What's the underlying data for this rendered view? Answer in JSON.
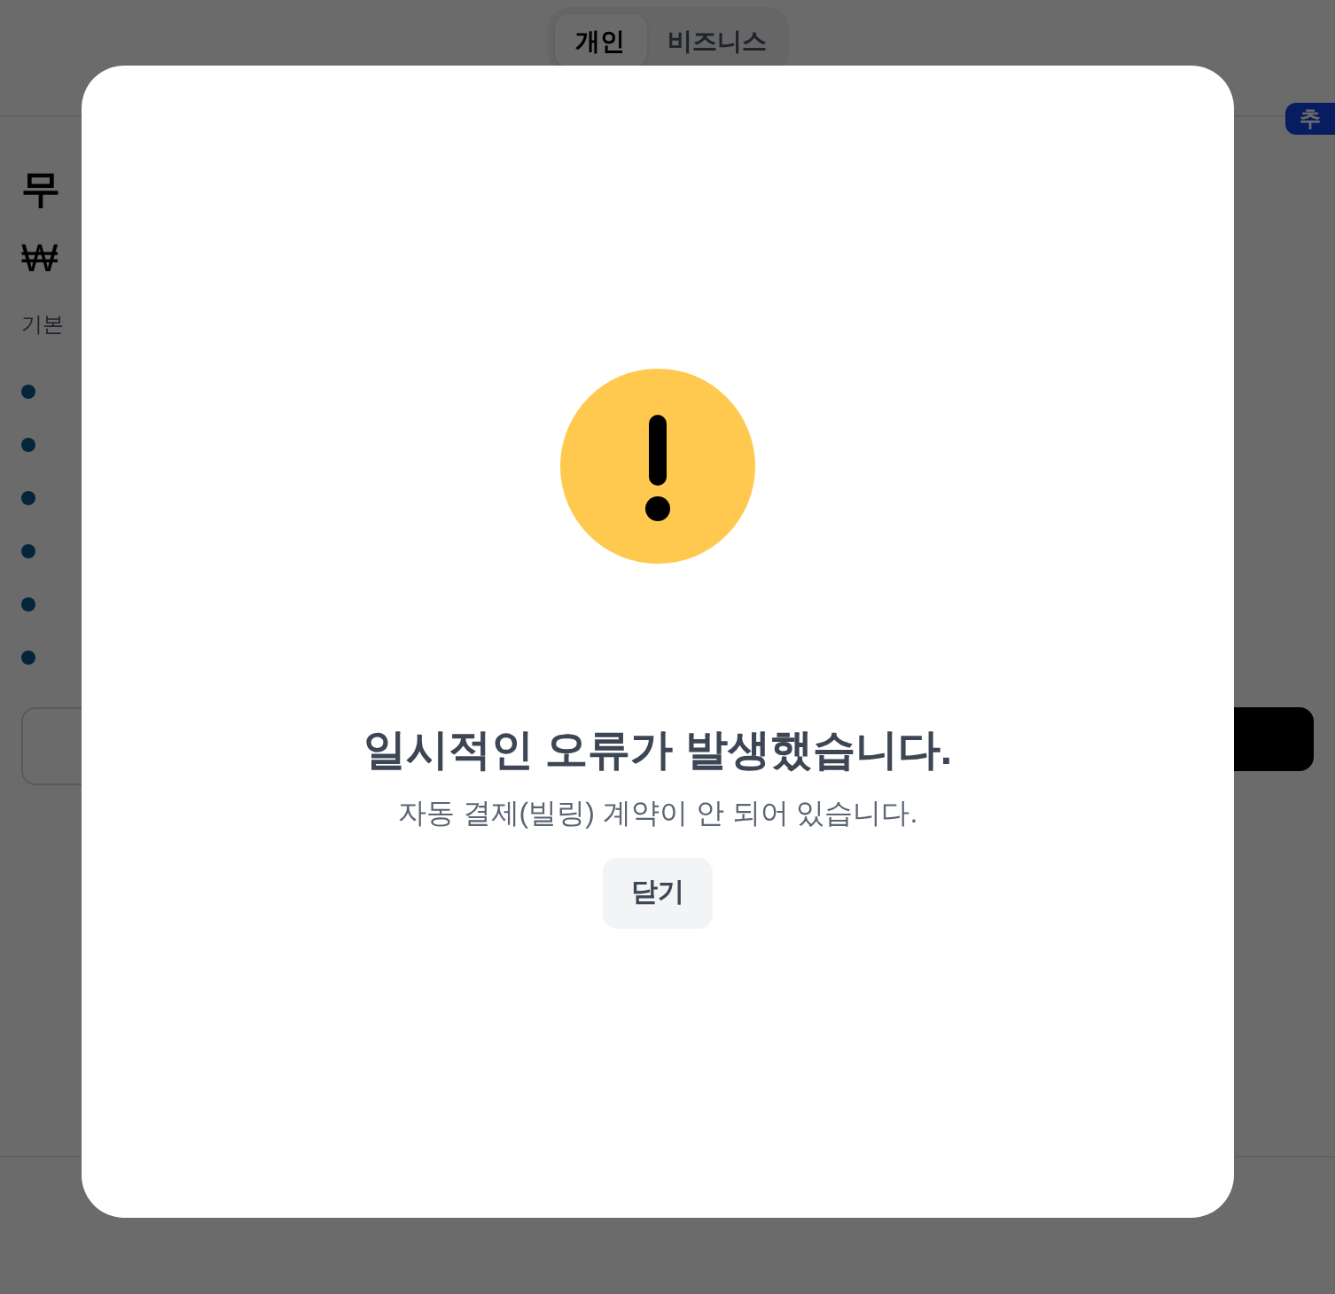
{
  "plan_tabs": [
    {
      "label": "개인",
      "selected": true
    },
    {
      "label": "비즈니스",
      "selected": false
    }
  ],
  "plan_card": {
    "badge": "추",
    "title": "무",
    "price": "₩",
    "description": "기본",
    "feature_bullets": [
      {
        "kind": "dot"
      },
      {
        "kind": "dot"
      },
      {
        "kind": "dot"
      },
      {
        "kind": "dot"
      },
      {
        "kind": "dot"
      },
      {
        "kind": "dot"
      }
    ]
  },
  "dialog": {
    "title": "일시적인 오류가 발생했습니다.",
    "message": "자동 결제(빌링) 계약이 안 되어 있습니다.",
    "close_button": "닫기"
  }
}
